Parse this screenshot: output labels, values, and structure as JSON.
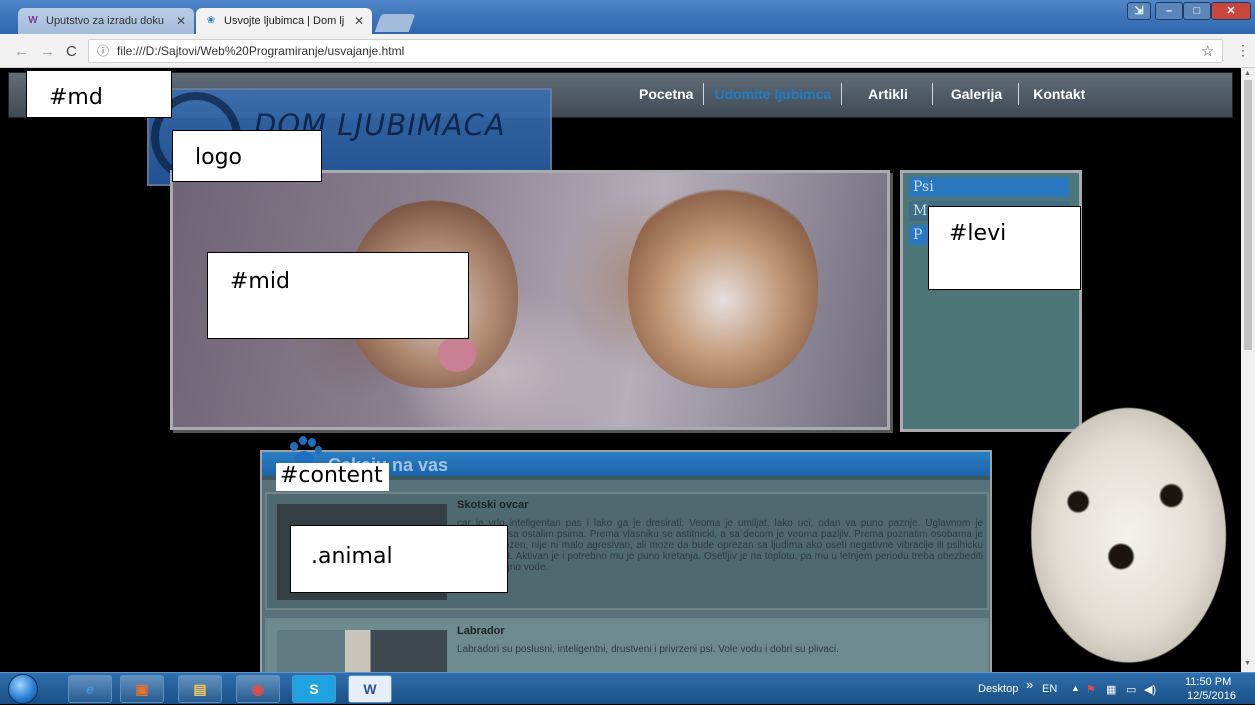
{
  "browser": {
    "tabs": [
      {
        "title": "Uputstvo za izradu doku",
        "favicon": "wd"
      },
      {
        "title": "Usvojte ljubimca | Dom lj",
        "favicon": "paw"
      }
    ],
    "url": "file:///D:/Sajtovi/Web%20Programiranje/usvajanje.html",
    "window_buttons": {
      "restore": "⇲",
      "minimize": "–",
      "maximize": "□",
      "close": "✕"
    }
  },
  "nav": {
    "links": [
      {
        "label": "Pocetna",
        "current": false
      },
      {
        "label": "Udomite ljubimca",
        "current": true
      },
      {
        "label": "Artikli",
        "current": false
      },
      {
        "label": "Galerija",
        "current": false
      },
      {
        "label": "Kontakt",
        "current": false
      }
    ]
  },
  "logo": {
    "text": "DOM LJUBIMACA"
  },
  "levi": {
    "items": [
      "Psi",
      "M",
      "P"
    ]
  },
  "content": {
    "title": "Cekaju na vas",
    "animals": [
      {
        "name": "Skotski ovcar",
        "desc": "car je vrlo inteligentan pas i lako ga je dresirati. Veoma je umiljat, lako uci, odan va puno paznje. Uglavnom je druzeljubiv sa ostalim psima. Prema vlasniku se astitnicki, a sa decom je veoma pazljiv. Prema poznatim osobama je vrlo raspolozen, nije ni malo agresivan, ali moze da bude oprezan sa ljudima ako oseti negativne vibracije ili psihicku nestabilnost. Aktivan je i potrebno mu je puno kretanja. Osetljiv je na toplotu, pa mu u letnjem periodu treba obezbediti hlad i dovoljno vode."
      },
      {
        "name": "Labrador",
        "desc": "Labradori su poslusni, inteligentni, drustveni i privrzeni psi. Vole vodu i dobri su plivaci."
      }
    ]
  },
  "annotations": {
    "md": "#md",
    "logo": "logo",
    "mid": "#mid",
    "levi": "#levi",
    "content": "#content",
    "animal": ".animal"
  },
  "taskbar": {
    "desktop": "Desktop",
    "chevron": "»",
    "lang": "EN",
    "time": "11:50 PM",
    "date": "12/5/2016"
  },
  "colors": {
    "nav_current": "#1e7ec8",
    "header_blue": "#2a7ec4",
    "panel_teal": "#4d7679"
  }
}
